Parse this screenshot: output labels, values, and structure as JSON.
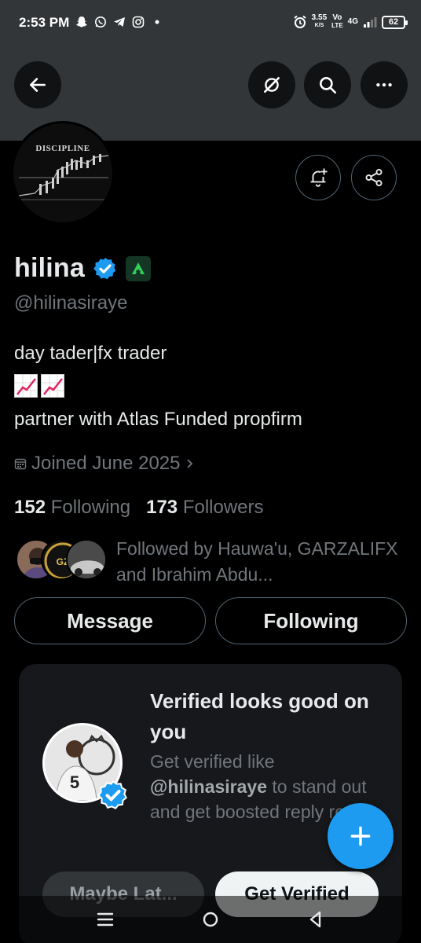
{
  "status_bar": {
    "time": "2:53 PM",
    "net_speed": "3.55",
    "net_speed_unit": "K/S",
    "volte": "Vo",
    "volte_sub": "LTE",
    "network": "4G",
    "battery": "62"
  },
  "profile": {
    "display_name": "hilina",
    "handle": "@hilinasiraye",
    "avatar_text": "DISCIPLINE",
    "bio_line1": "day tader|fx trader",
    "bio_line3": "partner with Atlas Funded propfirm",
    "joined": "Joined June 2025",
    "following_count": "152",
    "following_label": "Following",
    "followers_count": "173",
    "followers_label": "Followers",
    "followed_by_text": "Followed by Hauwa'u, GARZALIFX and Ibrahim Abdu..."
  },
  "actions": {
    "message_label": "Message",
    "following_label": "Following"
  },
  "promo": {
    "title": "Verified looks good on you",
    "desc_prefix": "Get verified like",
    "desc_handle": "@hilinasiraye",
    "desc_suffix": "to stand out and get boosted reply reach.",
    "maybe_label": "Maybe Lat...",
    "get_verified_label": "Get Verified"
  },
  "icons": {
    "back": "arrow-left-icon",
    "grok": "grok-icon",
    "search": "search-icon",
    "more": "more-horizontal-icon",
    "notify": "bell-plus-icon",
    "share": "share-icon",
    "calendar": "calendar-icon",
    "compose": "plus-icon"
  },
  "colors": {
    "accent": "#1d9bf0",
    "muted": "#71767b",
    "text": "#e7e9ea",
    "banner": "#333638"
  }
}
